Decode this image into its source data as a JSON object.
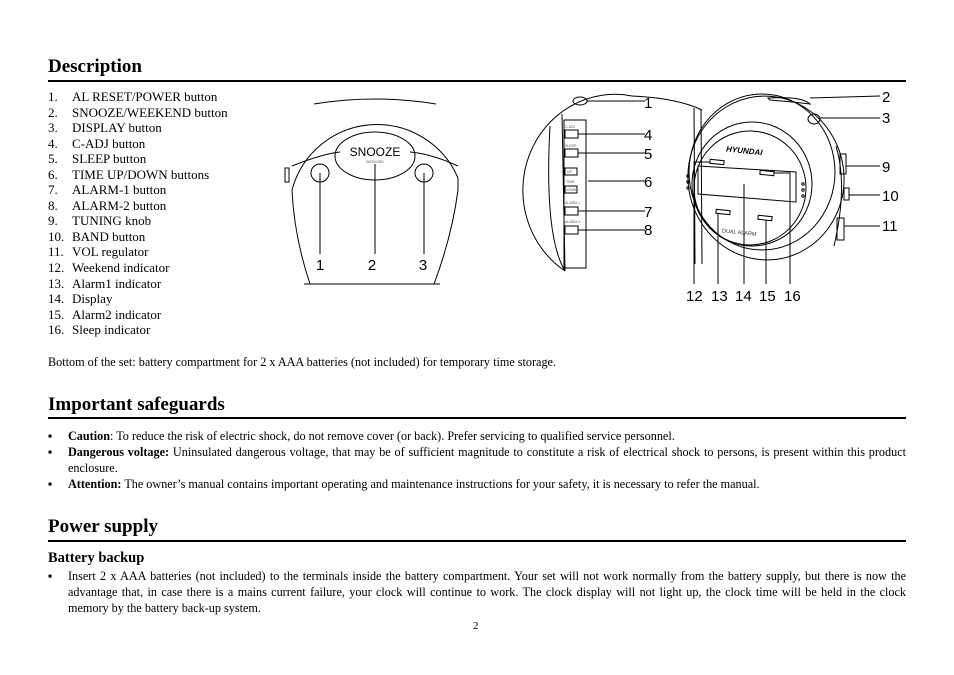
{
  "sections": {
    "description": {
      "title": "Description",
      "items": [
        {
          "num": "1.",
          "label": "AL RESET/POWER button"
        },
        {
          "num": "2.",
          "label": "SNOOZE/WEEKEND button"
        },
        {
          "num": "3.",
          "label": "DISPLAY button"
        },
        {
          "num": "4.",
          "label": "C-ADJ button"
        },
        {
          "num": "5.",
          "label": "SLEEP button"
        },
        {
          "num": "6.",
          "label": "TIME UP/DOWN buttons"
        },
        {
          "num": "7.",
          "label": "ALARM-1 button"
        },
        {
          "num": "8.",
          "label": "ALARM-2 button"
        },
        {
          "num": "9.",
          "label": "TUNING knob"
        },
        {
          "num": "10.",
          "label": "BAND button"
        },
        {
          "num": "11.",
          "label": "VOL regulator"
        },
        {
          "num": "12.",
          "label": "Weekend indicator"
        },
        {
          "num": "13.",
          "label": "Alarm1 indicator"
        },
        {
          "num": "14.",
          "label": "Display"
        },
        {
          "num": "15.",
          "label": "Alarm2 indicator"
        },
        {
          "num": "16.",
          "label": "Sleep indicator"
        }
      ],
      "bottom_note": "Bottom of the set: battery compartment for 2 x AAA batteries (not included) for temporary time storage."
    },
    "figure": {
      "front_view": {
        "snooze_label": "SNOOZE",
        "weekend_label": "WEEKEND",
        "callouts": [
          "1",
          "2",
          "3"
        ]
      },
      "side_view": {
        "button_labels": [
          "C-ADJ",
          "SLEEP",
          "UP",
          "TIME",
          "DOWN",
          "ALARM-1",
          "ALARM-2"
        ],
        "callouts": [
          "1",
          "4",
          "5",
          "6",
          "7",
          "8"
        ]
      },
      "angled_view": {
        "brand": "HYUNDAI",
        "dual_alarm": "DUAL ALARM",
        "callouts_right": [
          "2",
          "3",
          "9",
          "10",
          "11"
        ],
        "callouts_bottom": [
          "12",
          "13",
          "14",
          "15",
          "16"
        ]
      }
    },
    "safeguards": {
      "title": "Important safeguards",
      "bullets": [
        {
          "lead": "Caution",
          "sep": ": ",
          "text": "To reduce the risk of electric shock, do not remove cover (or back). Prefer servicing to qualified service personnel."
        },
        {
          "lead": "Dangerous voltage:",
          "sep": " ",
          "text": "Uninsulated dangerous voltage, that may be of sufficient magnitude to constitute a risk of electrical shock to persons, is present within this product enclosure."
        },
        {
          "lead": "Attention:",
          "sep": " ",
          "text": "The owner’s manual contains important operating and maintenance instructions for your safety, it is necessary to refer the manual."
        }
      ]
    },
    "power_supply": {
      "title": "Power supply",
      "subtitle": "Battery backup",
      "bullets": [
        {
          "text": "Insert 2 x AAA batteries (not included) to the terminals inside the battery compartment. Your set will not work normally from the battery supply, but there is now the advantage that, in case there is a mains current failure, your clock will continue to work. The clock display will not light up, the clock time will be held in the clock memory by the battery back-up system."
        }
      ]
    }
  },
  "bullet_glyph": "▪",
  "page_number": "2"
}
